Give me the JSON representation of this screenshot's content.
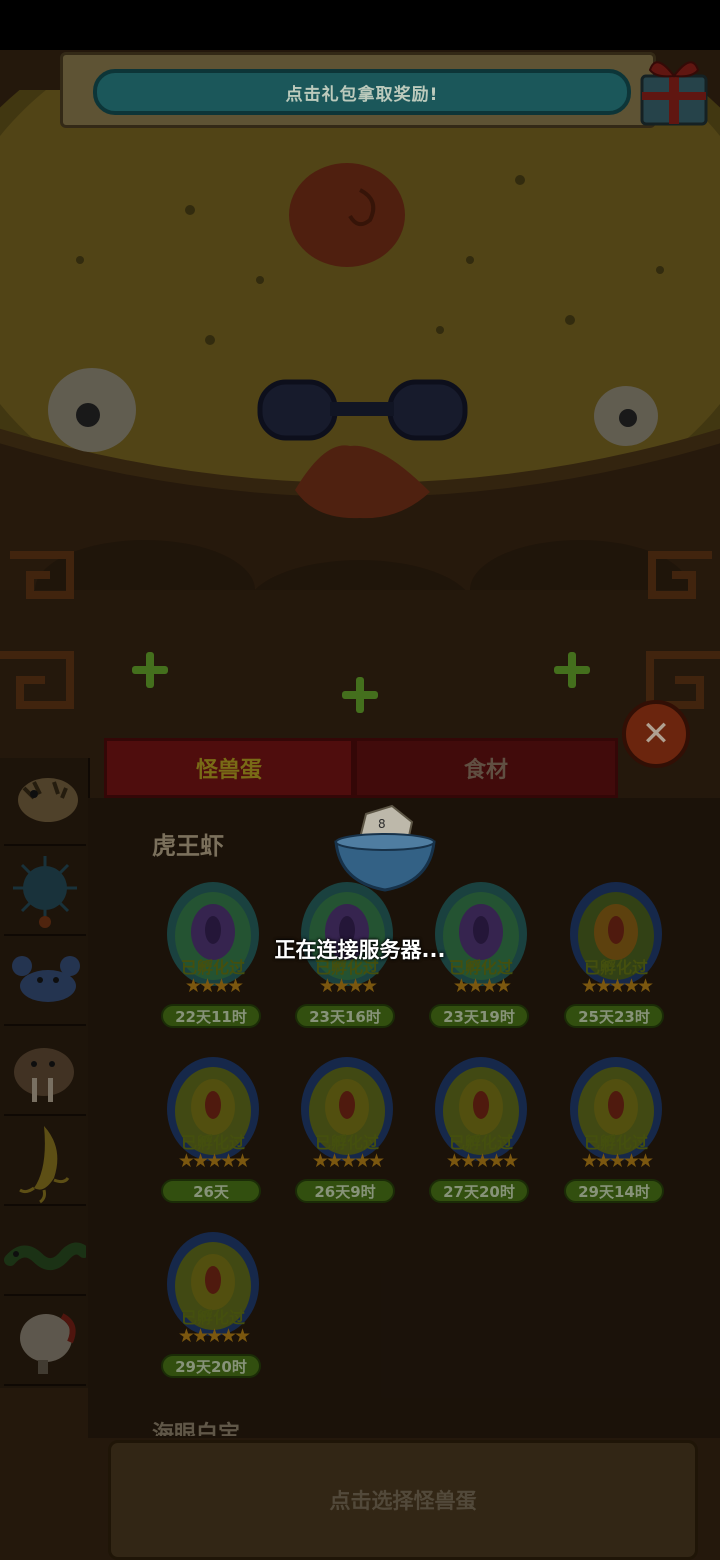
{
  "banner": {
    "text": "点击礼包拿取奖励!",
    "icon": "gift-box-icon"
  },
  "tabs": {
    "monster_egg": "怪兽蛋",
    "ingredients": "食材"
  },
  "close_icon": "close-icon",
  "rail_icons": [
    "tiger-shrimp-icon",
    "sea-urchin-icon",
    "crab-icon",
    "walrus-icon",
    "banana-squid-icon",
    "green-worm-icon",
    "clam-icon"
  ],
  "section": {
    "title": "虎王虾",
    "next_title_partial": "海眼白宝"
  },
  "eggs": [
    {
      "status": "已孵化过",
      "stars": "★★★★",
      "time": "22天11时",
      "variant": "purple"
    },
    {
      "status": "已孵化过",
      "stars": "★★★★",
      "time": "23天16时",
      "variant": "purple"
    },
    {
      "status": "已孵化过",
      "stars": "★★★★",
      "time": "23天19时",
      "variant": "purple"
    },
    {
      "status": "已孵化过",
      "stars": "★★★★★",
      "time": "25天23时",
      "variant": "blue"
    },
    {
      "status": "已孵化过",
      "stars": "★★★★★",
      "time": "26天",
      "variant": "yellow"
    },
    {
      "status": "已孵化过",
      "stars": "★★★★★",
      "time": "26天9时",
      "variant": "yellow"
    },
    {
      "status": "已孵化过",
      "stars": "★★★★★",
      "time": "27天20时",
      "variant": "yellow"
    },
    {
      "status": "已孵化过",
      "stars": "★★★★★",
      "time": "29天14时",
      "variant": "yellow"
    },
    {
      "status": "已孵化过",
      "stars": "★★★★★",
      "time": "29天20时",
      "variant": "yellow"
    }
  ],
  "bottom": {
    "prompt": "点击选择怪兽蛋"
  },
  "loading": {
    "text": "正在连接服务器..."
  }
}
